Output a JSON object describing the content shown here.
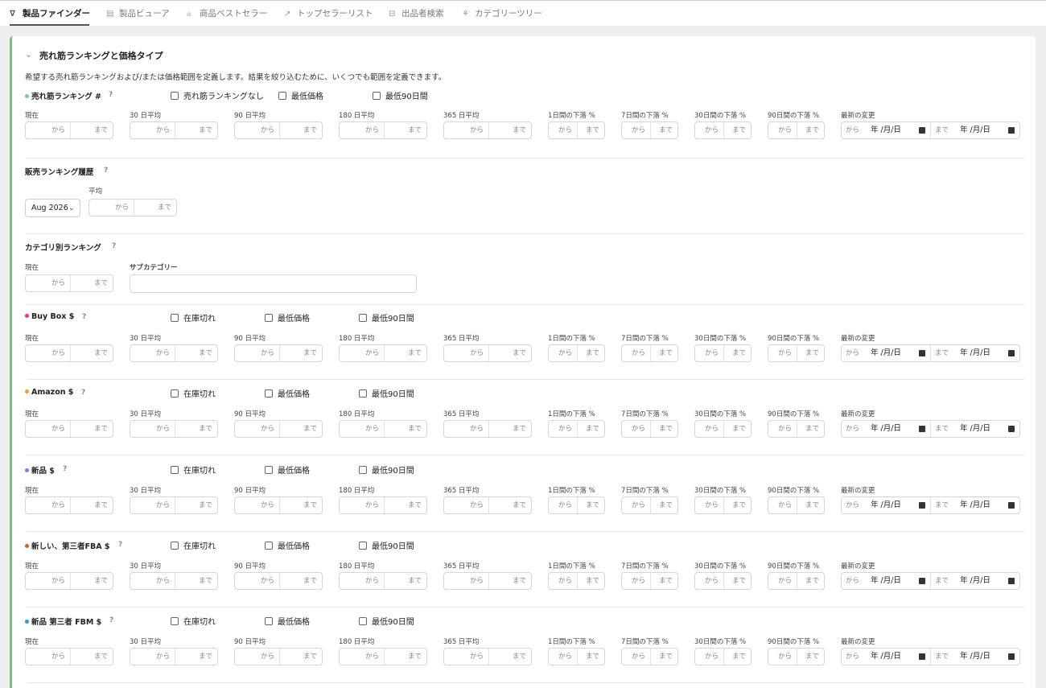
{
  "tabs": [
    {
      "icon": "filter-icon",
      "glyph": "∇",
      "label": "製品ファインダー",
      "active": true
    },
    {
      "icon": "table-icon",
      "glyph": "▤",
      "label": "製品ビューア",
      "active": false
    },
    {
      "icon": "bar-chart-icon",
      "glyph": "ılı",
      "label": "商品ベストセラー",
      "active": false
    },
    {
      "icon": "trend-up-icon",
      "glyph": "↗",
      "label": "トップセラーリスト",
      "active": false
    },
    {
      "icon": "database-icon",
      "glyph": "⊟",
      "label": "出品者検索",
      "active": false
    },
    {
      "icon": "tree-icon",
      "glyph": "⚘",
      "label": "カテゴリーツリー",
      "active": false
    }
  ],
  "section": {
    "title": "売れ筋ランキングと価格タイプ",
    "description": "希望する売れ筋ランキングおよび/または価格範囲を定義します。結果を絞り込むために、いくつでも範囲を定義できます。"
  },
  "common": {
    "from": "から",
    "to": "まで",
    "help": "?",
    "date_placeholder": "年 /月/日",
    "chevron": "⌄"
  },
  "column_labels": [
    "現在",
    "30 日平均",
    "90 日平均",
    "180 日平均",
    "365 日平均",
    "1日間の下落 %",
    "7日間の下落 %",
    "30日間の下落 %",
    "90日間の下落 %",
    "最新の変更"
  ],
  "rank_block": {
    "title": "売れ筋ランキング #",
    "dot_color": "#8bc48b",
    "checkboxes": [
      "売れ筋ランキングなし",
      "最低価格",
      "最低90日間"
    ]
  },
  "history_block": {
    "title": "販売ランキング履歴",
    "select_value": "Aug 2026",
    "avg_label": "平均"
  },
  "category_block": {
    "title": "カテゴリ別ランキング",
    "current_label": "現在",
    "subcategory_label": "サブカテゴリー"
  },
  "price_blocks": [
    {
      "title": "Buy Box $",
      "dot_color": "#e0359a",
      "checkboxes": [
        "在庫切れ",
        "最低価格",
        "最低90日間"
      ]
    },
    {
      "title": "Amazon $",
      "dot_color": "#f0a020",
      "checkboxes": [
        "在庫切れ",
        "最低価格",
        "最低90日間"
      ]
    },
    {
      "title": "新品 $",
      "dot_color": "#8a7ad0",
      "checkboxes": [
        "在庫切れ",
        "最低価格",
        "最低90日間"
      ]
    },
    {
      "title": "新しい、第三者FBA $",
      "dot_color": "#e0552a",
      "checkboxes": [
        "在庫切れ",
        "最低価格",
        "最低90日間"
      ]
    },
    {
      "title": "新品 第三者 FBM $",
      "dot_color": "#2aa0c0",
      "checkboxes": [
        "在庫切れ",
        "最低価格",
        "最低90日間"
      ]
    }
  ]
}
